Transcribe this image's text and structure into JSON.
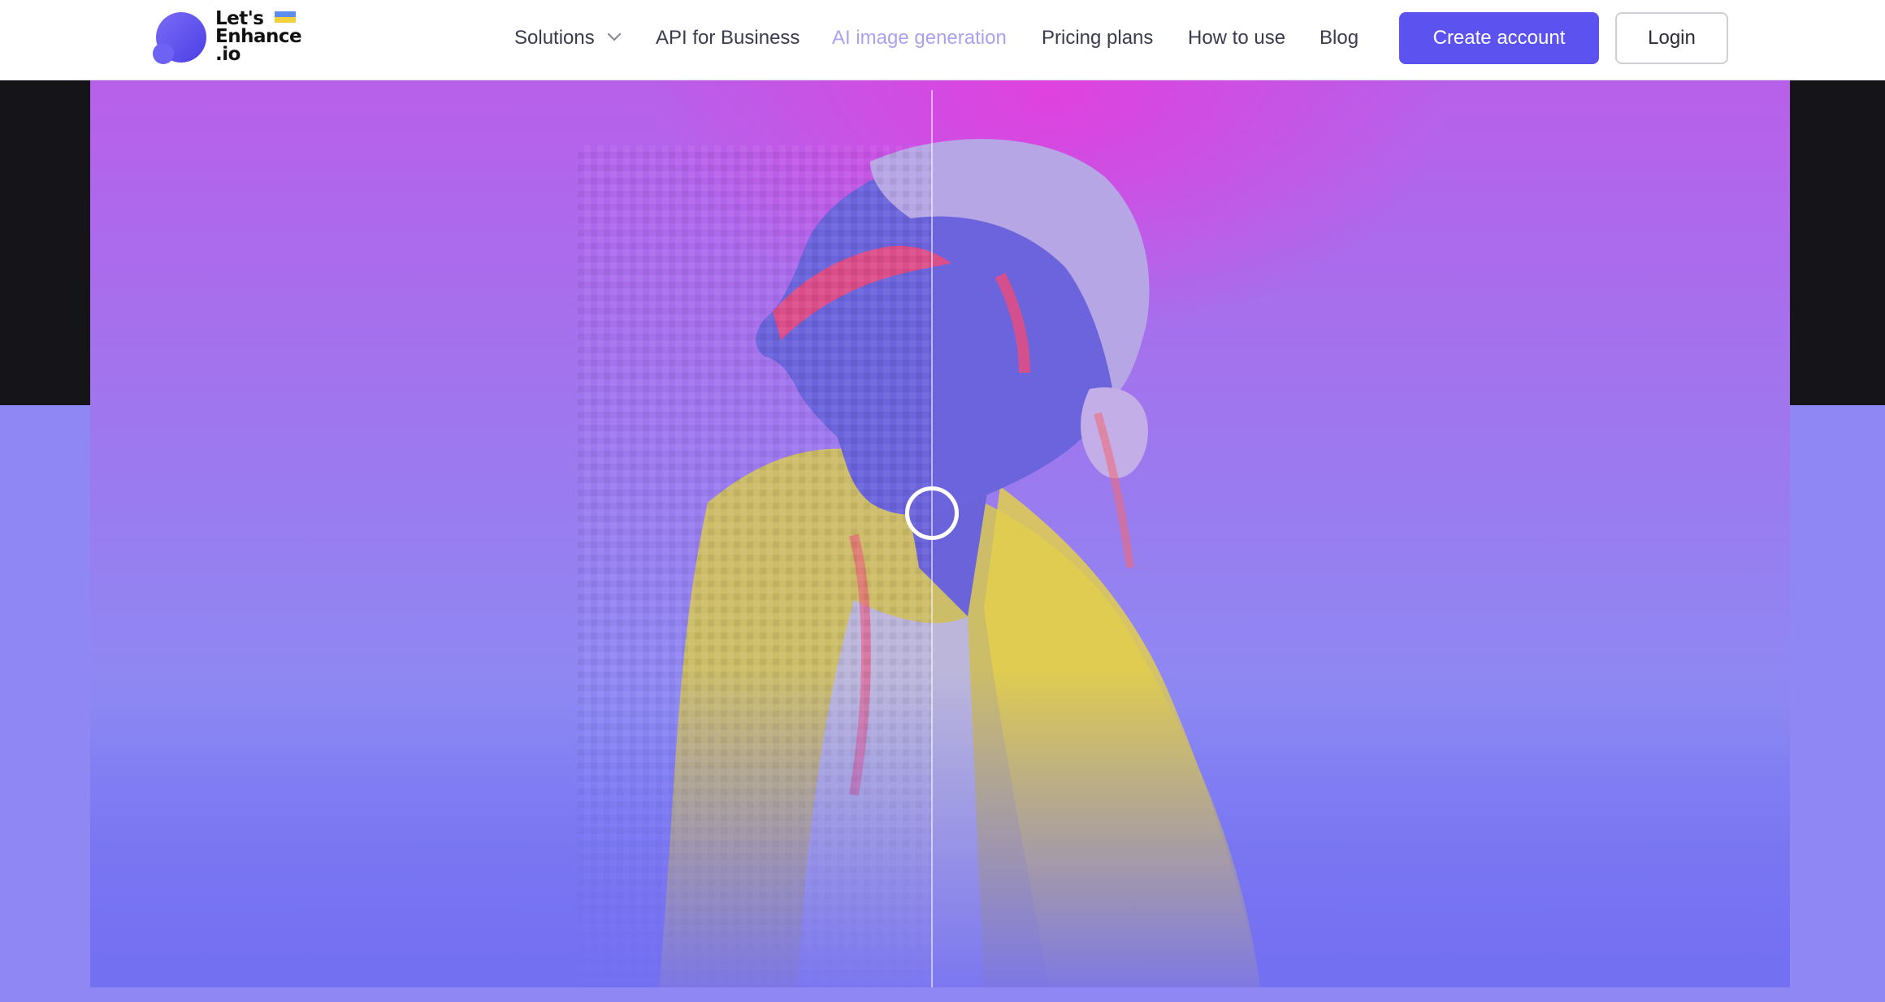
{
  "brand": {
    "name_line1": "Let's",
    "name_line2": "Enhance",
    "name_line3": ".io",
    "logo_color": "#5b52ef",
    "flag_colors": [
      "#5b8ef0",
      "#f3d03e"
    ]
  },
  "nav": {
    "items": [
      {
        "label": "Solutions",
        "has_dropdown": true
      },
      {
        "label": "API for Business"
      },
      {
        "label": "AI image generation",
        "active": true
      },
      {
        "label": "Pricing plans"
      },
      {
        "label": "How to use"
      },
      {
        "label": "Blog"
      }
    ]
  },
  "actions": {
    "create_account": "Create account",
    "login": "Login"
  },
  "colors": {
    "primary": "#5b52ef",
    "nav_text": "#3b3b4f",
    "nav_active": "#a9a2ef",
    "hero_top": "#b85fea",
    "hero_bottom": "#7470f2"
  },
  "hero": {
    "comparison_slider": {
      "position": 0.5
    }
  }
}
